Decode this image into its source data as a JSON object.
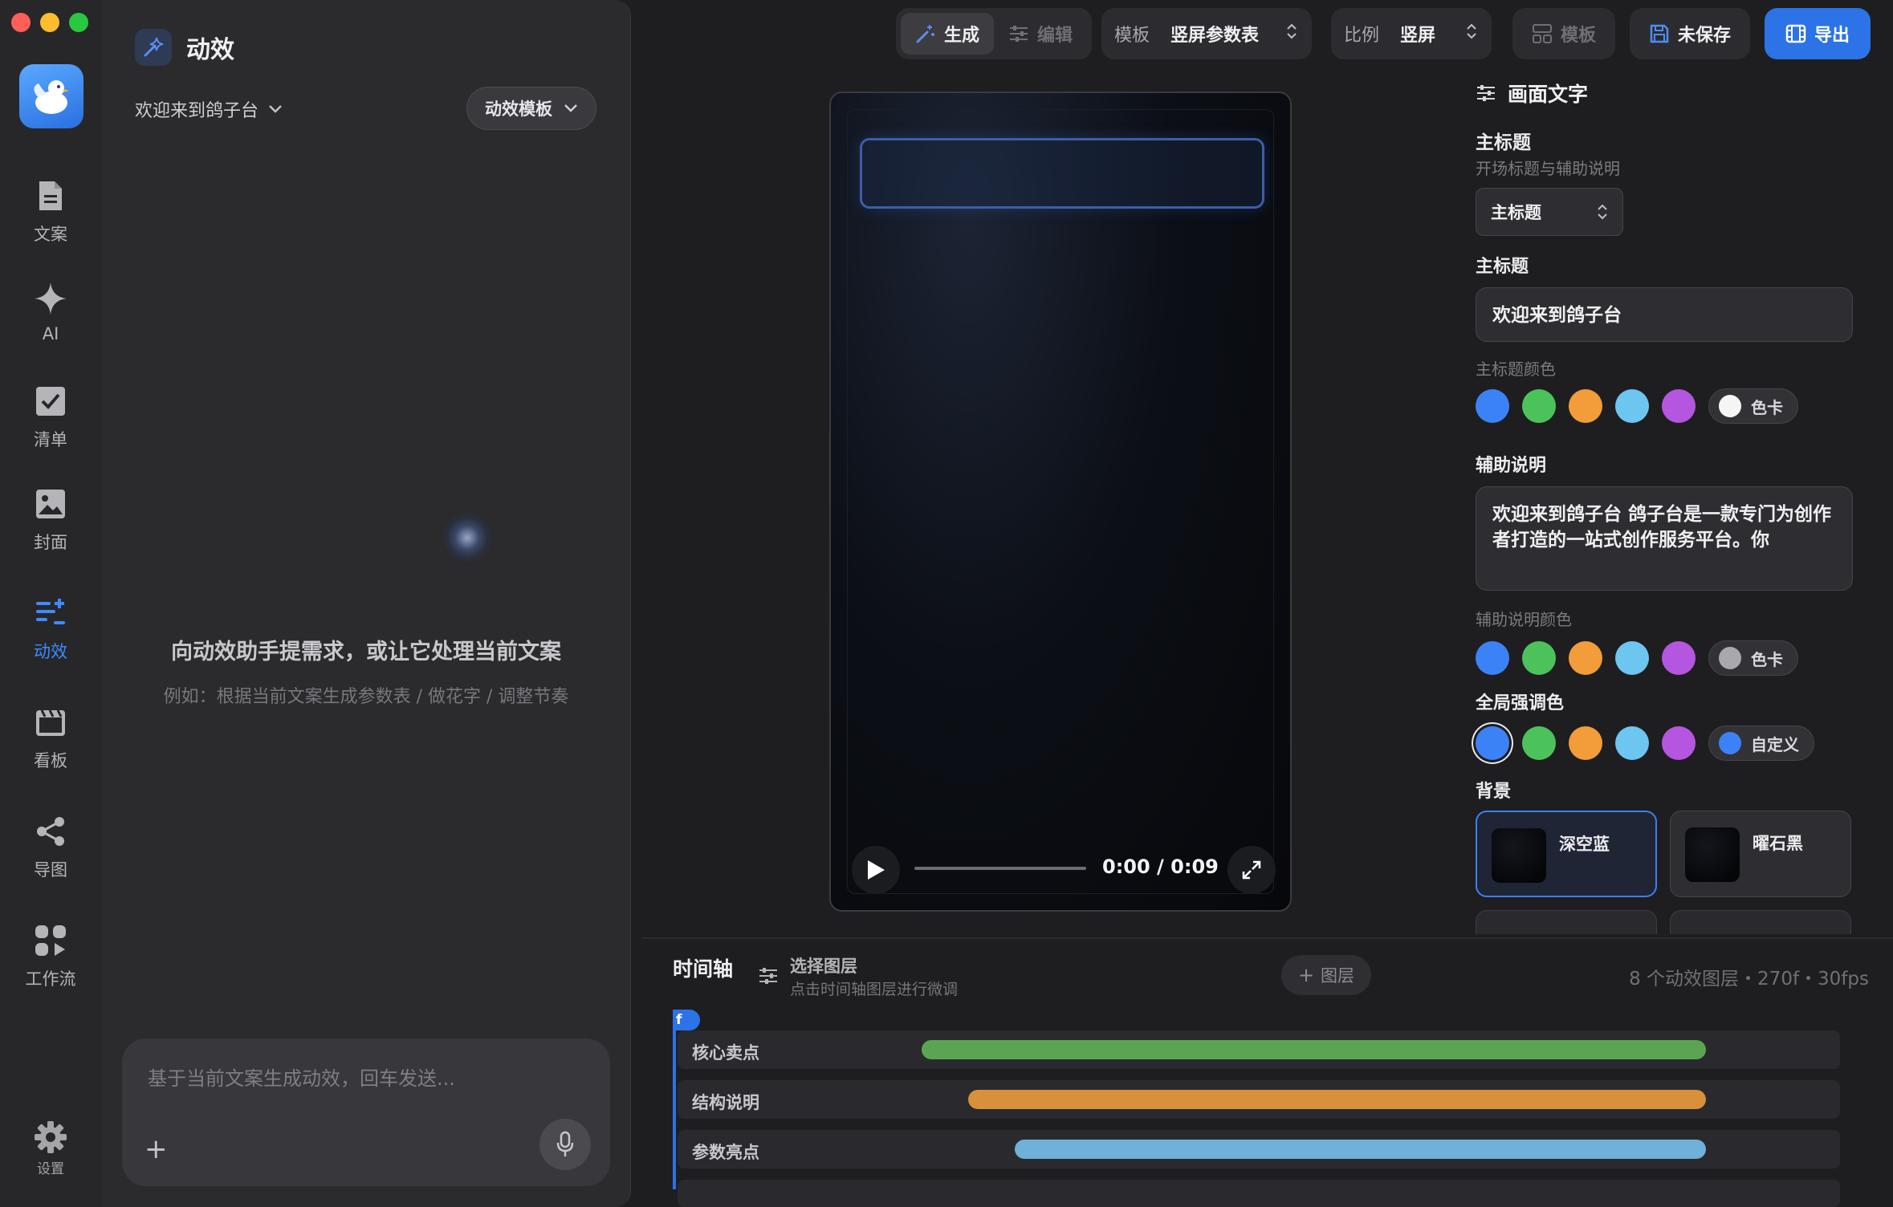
{
  "rail": {
    "items": [
      {
        "label": "文案",
        "icon": "document-icon"
      },
      {
        "label": "AI",
        "icon": "sparkle-icon"
      },
      {
        "label": "清单",
        "icon": "checkbox-icon"
      },
      {
        "label": "封面",
        "icon": "image-icon"
      },
      {
        "label": "动效",
        "icon": "motion-icon",
        "active": true
      },
      {
        "label": "看板",
        "icon": "clapperboard-icon"
      },
      {
        "label": "导图",
        "icon": "share-graph-icon"
      },
      {
        "label": "工作流",
        "icon": "workflow-icon"
      }
    ],
    "settings_label": "设置"
  },
  "panel": {
    "title": "动效",
    "doc_select": "欢迎来到鸽子台",
    "template_button": "动效模板",
    "empty_title": "向动效助手提需求，或让它处理当前文案",
    "empty_sub": "例如：根据当前文案生成参数表 / 做花字 / 调整节奏",
    "chat_placeholder": "基于当前文案生成动效，回车发送..."
  },
  "toolbar": {
    "generate": "生成",
    "edit": "编辑",
    "template_label": "模板",
    "template_value": "竖屏参数表",
    "ratio_label": "比例",
    "ratio_value": "竖屏",
    "board": "模板",
    "save": "未保存",
    "export": "导出"
  },
  "preview": {
    "timecode": "0:00 / 0:09",
    "progress": 0
  },
  "props": {
    "section_title": "画面文字",
    "main_title_heading": "主标题",
    "main_title_sub": "开场标题与辅助说明",
    "select_value": "主标题",
    "field_label": "主标题",
    "field_value": "欢迎来到鸽子台",
    "title_color_label": "主标题颜色",
    "swatch_colors": [
      "#3b82f6",
      "#4cc35a",
      "#f29c3a",
      "#6cc6f0",
      "#b456e0"
    ],
    "title_chip": "色卡",
    "title_chip_color": "#f5f5f5",
    "aux_label": "辅助说明",
    "aux_value": "欢迎来到鸽子台 鸽子台是一款专门为创作者打造的一站式创作服务平台。你",
    "aux_color_label": "辅助说明颜色",
    "aux_chip": "色卡",
    "aux_chip_color": "#a8a8ae",
    "accent_label": "全局强调色",
    "accent_chip": "自定义",
    "accent_chip_color": "#3b82f6",
    "bg_label": "背景",
    "bg_options": [
      {
        "name": "深空蓝",
        "selected": true
      },
      {
        "name": "曜石黑",
        "selected": false
      }
    ]
  },
  "timeline": {
    "title": "时间轴",
    "select_layer": "选择图层",
    "select_hint": "点击时间轴图层进行微调",
    "add_layer": "图层",
    "meta": "8 个动效图层・270f・30fps",
    "playhead_label": "f",
    "tracks": [
      {
        "name": "核心卖点",
        "color": "#5aa552",
        "start": 0.21,
        "end": 0.885
      },
      {
        "name": "结构说明",
        "color": "#d9903a",
        "start": 0.25,
        "end": 0.885
      },
      {
        "name": "参数亮点",
        "color": "#6fb1d8",
        "start": 0.29,
        "end": 0.885
      }
    ]
  }
}
